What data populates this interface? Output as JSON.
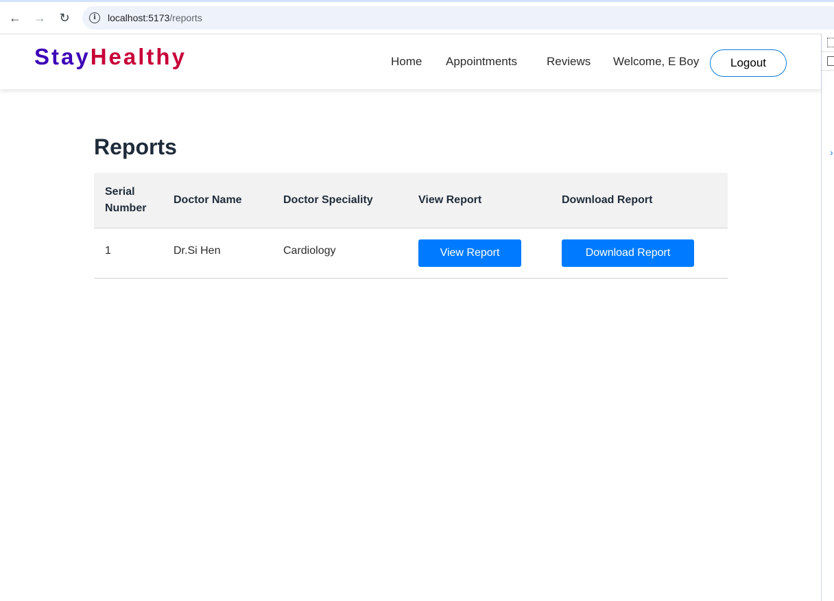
{
  "browser": {
    "url_host": "localhost:5173",
    "url_path": "/reports"
  },
  "brand": {
    "part1": "Stay",
    "part2": "Healthy"
  },
  "nav": {
    "home": "Home",
    "appointments": "Appointments",
    "reviews": "Reviews",
    "welcome": "Welcome, E Boy",
    "logout": "Logout"
  },
  "page": {
    "title": "Reports"
  },
  "table": {
    "headers": [
      "Serial Number",
      "Doctor Name",
      "Doctor Speciality",
      "View Report",
      "Download Report"
    ],
    "rows": [
      {
        "serial": "1",
        "doctor": "Dr.Si Hen",
        "speciality": "Cardiology",
        "view": "View Report",
        "download": "Download Report"
      }
    ]
  },
  "colors": {
    "brand_stay": "#3d00b7",
    "brand_healthy": "#c70039",
    "button_primary": "#007bff",
    "logout_border": "#0b7adb"
  }
}
